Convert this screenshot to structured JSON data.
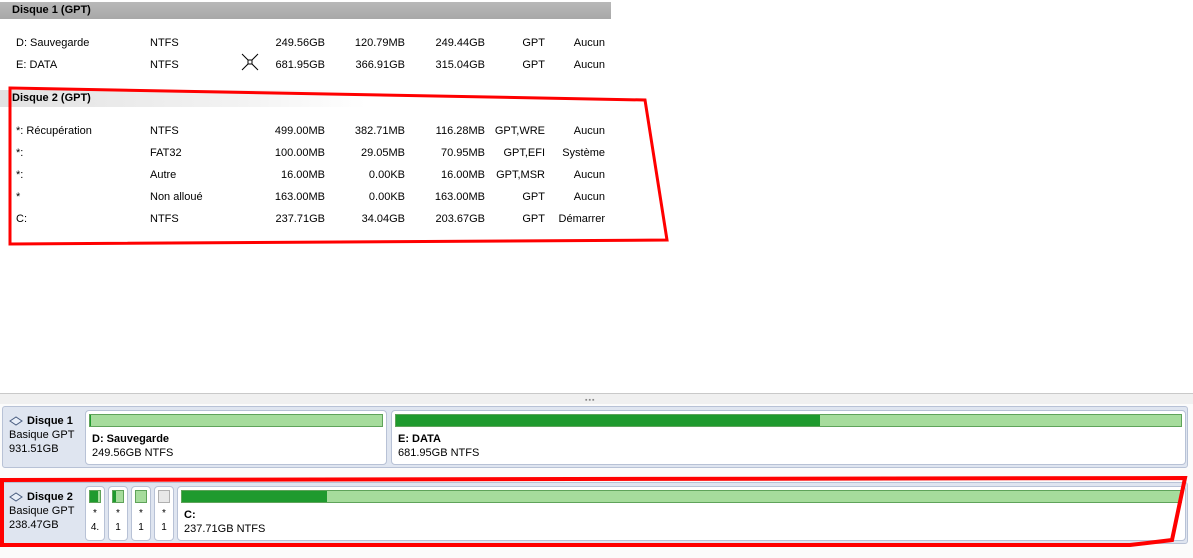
{
  "disks_list": [
    {
      "header": "Disque 1 (GPT)",
      "partitions": [
        {
          "name": "D: Sauvegarde",
          "fs": "NTFS",
          "capacity": "249.56GB",
          "used": "120.79MB",
          "free": "249.44GB",
          "type": "GPT",
          "status": "Aucun"
        },
        {
          "name": "E: DATA",
          "fs": "NTFS",
          "capacity": "681.95GB",
          "used": "366.91GB",
          "free": "315.04GB",
          "type": "GPT",
          "status": "Aucun"
        }
      ]
    },
    {
      "header": "Disque 2 (GPT)",
      "partitions": [
        {
          "name": "*: Récupération",
          "fs": "NTFS",
          "capacity": "499.00MB",
          "used": "382.71MB",
          "free": "116.28MB",
          "type": "GPT,WRE",
          "status": "Aucun"
        },
        {
          "name": "*:",
          "fs": "FAT32",
          "capacity": "100.00MB",
          "used": "29.05MB",
          "free": "70.95MB",
          "type": "GPT,EFI",
          "status": "Système"
        },
        {
          "name": "*:",
          "fs": "Autre",
          "capacity": "16.00MB",
          "used": "0.00KB",
          "free": "16.00MB",
          "type": "GPT,MSR",
          "status": "Aucun"
        },
        {
          "name": "*",
          "fs": "Non alloué",
          "capacity": "163.00MB",
          "used": "0.00KB",
          "free": "163.00MB",
          "type": "GPT",
          "status": "Aucun"
        },
        {
          "name": "C:",
          "fs": "NTFS",
          "capacity": "237.71GB",
          "used": "34.04GB",
          "free": "203.67GB",
          "type": "GPT",
          "status": "Démarrer"
        }
      ]
    }
  ],
  "disk_map": [
    {
      "name": "Disque 1",
      "kind": "Basique GPT",
      "size": "931.51GB",
      "partitions": [
        {
          "label": "D: Sauvegarde",
          "detail": "249.56GB NTFS",
          "used_fraction": 0.0005
        },
        {
          "label": "E: DATA",
          "detail": "681.95GB NTFS",
          "used_fraction": 0.54
        }
      ]
    },
    {
      "name": "Disque 2",
      "kind": "Basique GPT",
      "size": "238.47GB",
      "small_partitions": [
        {
          "line1": "*",
          "line2": "4.",
          "used_fraction": 0.77
        },
        {
          "line1": "*",
          "line2": "1",
          "used_fraction": 0.29
        },
        {
          "line1": "*",
          "line2": "1",
          "used_fraction": 0.0
        },
        {
          "line1": "*",
          "line2": "1",
          "used_fraction": 0.0,
          "unallocated": true
        }
      ],
      "main_partition": {
        "label": "C:",
        "detail": "237.71GB NTFS",
        "used_fraction": 0.145
      }
    }
  ],
  "icons": {
    "cursor": "move-cursor-icon",
    "disk": "disk-icon"
  },
  "colors": {
    "bar_used": "#1f9a2e",
    "bar_free": "#a6dc9c",
    "annotation": "#ff0000"
  }
}
